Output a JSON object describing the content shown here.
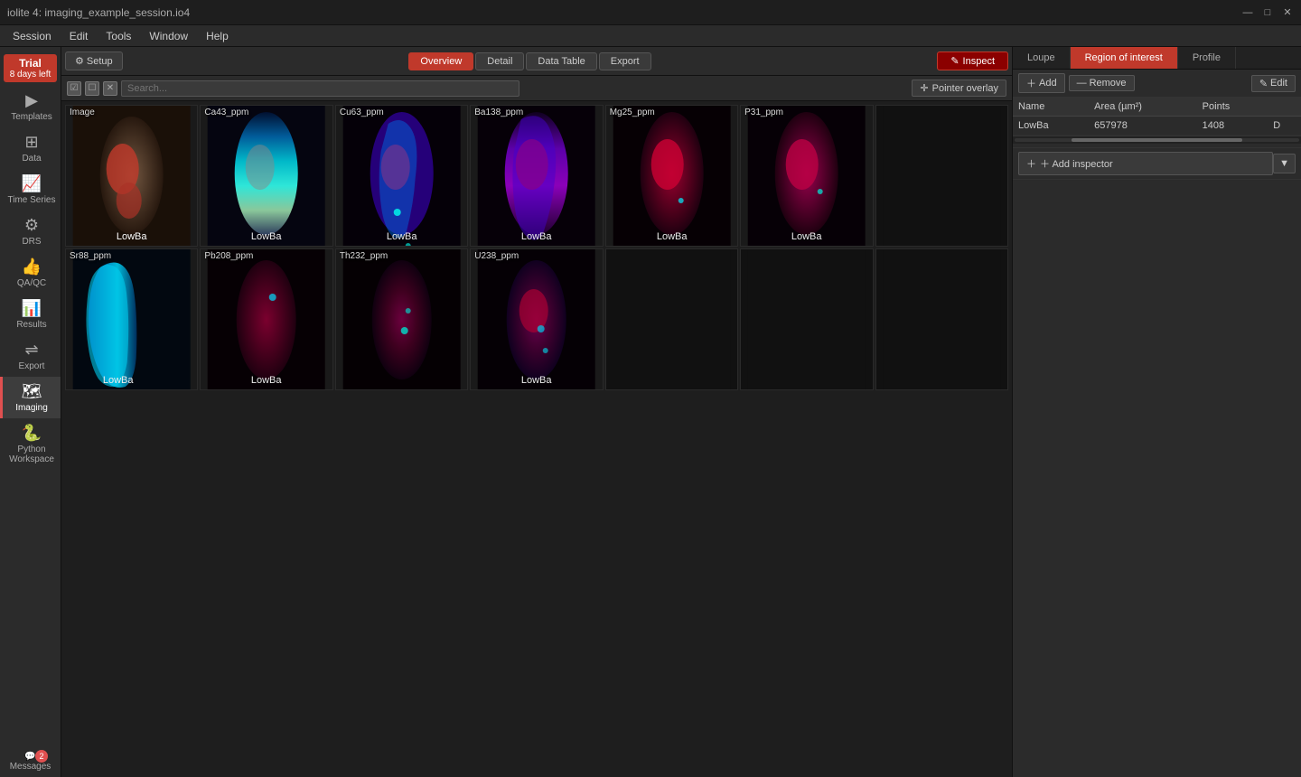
{
  "titlebar": {
    "title": "iolite 4: imaging_example_session.io4",
    "minimize": "—",
    "maximize": "□",
    "close": "✕"
  },
  "menubar": {
    "items": [
      "Session",
      "Edit",
      "Tools",
      "Window",
      "Help"
    ]
  },
  "toolbar": {
    "setup_label": "⚙ Setup",
    "tabs": [
      "Overview",
      "Detail",
      "Data Table",
      "Export"
    ],
    "active_tab": "Overview",
    "inspect_label": "✎ Inspect"
  },
  "secondary_toolbar": {
    "search_placeholder": "Search...",
    "pointer_overlay_label": "✛ Pointer overlay"
  },
  "sidebar": {
    "trial_label": "Trial",
    "trial_days": "8 days left",
    "items": [
      {
        "id": "templates",
        "label": "Templates",
        "icon": "▶"
      },
      {
        "id": "data",
        "label": "Data",
        "icon": "⊞"
      },
      {
        "id": "timeseries",
        "label": "Time Series",
        "icon": "📈"
      },
      {
        "id": "drs",
        "label": "DRS",
        "icon": "⚙"
      },
      {
        "id": "qaqc",
        "label": "QA/QC",
        "icon": "👍"
      },
      {
        "id": "results",
        "label": "Results",
        "icon": "📊"
      },
      {
        "id": "export",
        "label": "Export",
        "icon": "⇌"
      },
      {
        "id": "imaging",
        "label": "Imaging",
        "icon": "🗺"
      },
      {
        "id": "python",
        "label": "Python Workspace",
        "icon": "🐍"
      }
    ],
    "active": "imaging",
    "messages_label": "Messages",
    "messages_badge": "2"
  },
  "grid": {
    "row1": [
      {
        "id": "photo",
        "label": "Image",
        "roi": ""
      },
      {
        "id": "ca43",
        "label": "Ca43_ppm",
        "roi": "LowBa"
      },
      {
        "id": "cu63",
        "label": "Cu63_ppm",
        "roi": "LowBa"
      },
      {
        "id": "ba138",
        "label": "Ba138_ppm",
        "roi": "LowBa"
      },
      {
        "id": "mg25",
        "label": "Mg25_ppm",
        "roi": "LowBa"
      },
      {
        "id": "p31",
        "label": "P31_ppm",
        "roi": "LowBa"
      },
      {
        "id": "empty1",
        "label": "",
        "roi": ""
      }
    ],
    "row2": [
      {
        "id": "sr88",
        "label": "Sr88_ppm",
        "roi": "LowBa"
      },
      {
        "id": "pb208",
        "label": "Pb208_ppm",
        "roi": "LowBa"
      },
      {
        "id": "th232",
        "label": "Th232_ppm",
        "roi": ""
      },
      {
        "id": "u238",
        "label": "U238_ppm",
        "roi": "LowBa"
      },
      {
        "id": "empty2",
        "label": "",
        "roi": ""
      },
      {
        "id": "empty3",
        "label": "",
        "roi": ""
      },
      {
        "id": "empty4",
        "label": "",
        "roi": ""
      }
    ]
  },
  "right_panel": {
    "tabs": [
      "Loupe",
      "Region of interest",
      "Profile"
    ],
    "active_tab": "Region of interest",
    "toolbar": {
      "add_label": "＋ Add",
      "remove_label": "— Remove",
      "edit_label": "✎ Edit"
    },
    "table": {
      "headers": [
        "Name",
        "Area (µm²)",
        "Points",
        ""
      ],
      "rows": [
        {
          "name": "LowBa",
          "area": "657978",
          "points": "1408",
          "delete": "D"
        }
      ]
    },
    "add_inspector_label": "＋ Add inspector",
    "add_inspector_dropdown": "▼"
  }
}
